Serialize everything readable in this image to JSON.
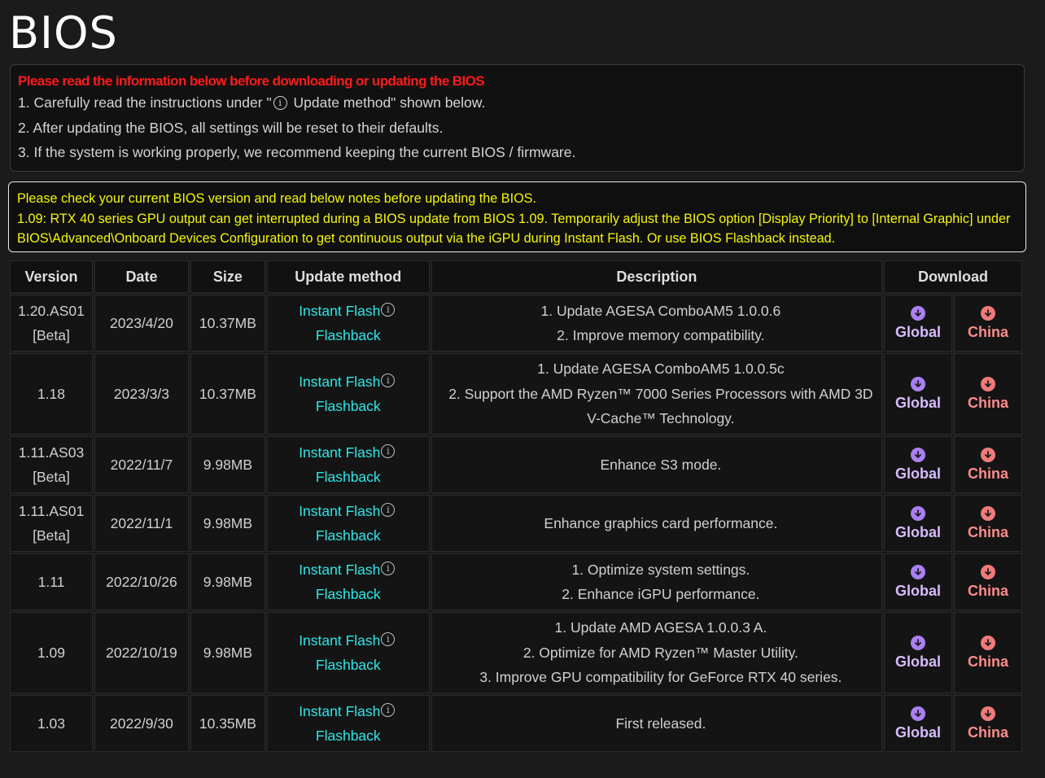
{
  "page": {
    "title": "BIOS"
  },
  "notice": {
    "warning": "Please read the information below before downloading or updating the BIOS",
    "line1_pre": "1. Carefully read the instructions under \"",
    "line1_post": " Update method\" shown below.",
    "line2": "2. After updating the BIOS, all settings will be reset to their defaults.",
    "line3": "3. If the system is working properly, we recommend keeping the current BIOS / firmware."
  },
  "yellow_notice": {
    "line1": "Please check your current BIOS version and read below notes before updating the BIOS.",
    "line2": "1.09: RTX 40 series GPU output can get interrupted during a BIOS update from BIOS 1.09. Temporarily adjust the BIOS option [Display Priority] to [Internal Graphic] under BIOS\\Advanced\\Onboard Devices Configuration to get continuous output via the iGPU during Instant Flash. Or use BIOS Flashback instead."
  },
  "table": {
    "headers": [
      "Version",
      "Date",
      "Size",
      "Update method",
      "Description",
      "Download"
    ],
    "method_labels": {
      "instant": "Instant Flash",
      "flashback": "Flashback"
    },
    "download_labels": {
      "global": "Global",
      "china": "China"
    },
    "colors": {
      "link": "#2ee6e6",
      "global": "#a980f2",
      "china": "#f07a7a",
      "warning": "#ff1a1a",
      "note": "#f5f50a"
    },
    "rows": [
      {
        "version": [
          "1.20.AS01",
          "[Beta]"
        ],
        "date": "2023/4/20",
        "size": "10.37MB",
        "desc": [
          "1. Update AGESA ComboAM5 1.0.0.6",
          "2. Improve memory compatibility."
        ]
      },
      {
        "version": [
          "1.18"
        ],
        "date": "2023/3/3",
        "size": "10.37MB",
        "desc": [
          "1. Update AGESA ComboAM5 1.0.0.5c",
          "2. Support the AMD Ryzen™ 7000 Series Processors with AMD 3D",
          "V-Cache™ Technology."
        ]
      },
      {
        "version": [
          "1.11.AS03",
          "[Beta]"
        ],
        "date": "2022/11/7",
        "size": "9.98MB",
        "desc": [
          "Enhance S3 mode."
        ]
      },
      {
        "version": [
          "1.11.AS01",
          "[Beta]"
        ],
        "date": "2022/11/1",
        "size": "9.98MB",
        "desc": [
          "Enhance graphics card performance."
        ]
      },
      {
        "version": [
          "1.11"
        ],
        "date": "2022/10/26",
        "size": "9.98MB",
        "desc": [
          "1. Optimize system settings.",
          "2. Enhance iGPU performance."
        ]
      },
      {
        "version": [
          "1.09"
        ],
        "date": "2022/10/19",
        "size": "9.98MB",
        "desc": [
          "1. Update AMD AGESA 1.0.0.3 A.",
          "2. Optimize for AMD Ryzen™ Master Utility.",
          "3. Improve GPU compatibility for GeForce RTX 40 series."
        ]
      },
      {
        "version": [
          "1.03"
        ],
        "date": "2022/9/30",
        "size": "10.35MB",
        "desc": [
          "First released."
        ]
      }
    ]
  }
}
